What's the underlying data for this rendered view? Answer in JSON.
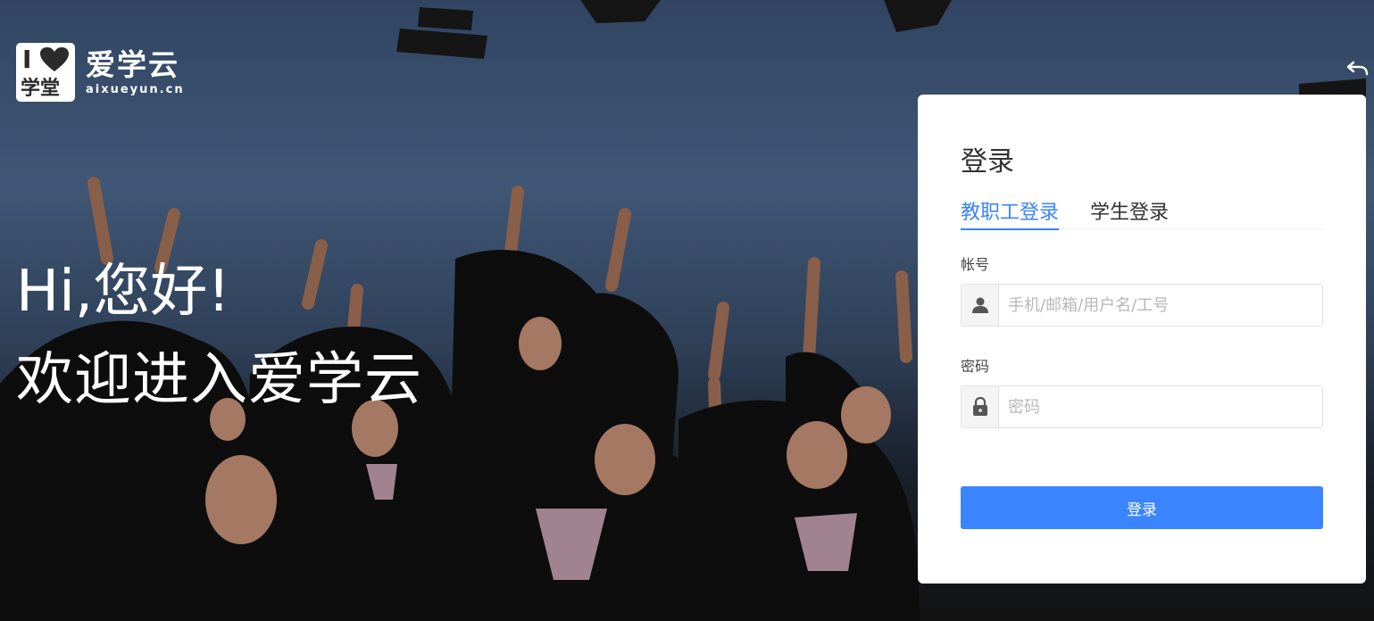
{
  "brand": {
    "badge_letter": "I",
    "badge_text": "学堂",
    "name": "爱学云",
    "domain": "aixueyun.cn"
  },
  "welcome": {
    "line1": "Hi,您好!",
    "line2": "欢迎进入爱学云"
  },
  "login": {
    "title": "登录",
    "tabs": [
      {
        "label": "教职工登录",
        "active": true
      },
      {
        "label": "学生登录",
        "active": false
      }
    ],
    "account_label": "帐号",
    "account_placeholder": "手机/邮箱/用户名/工号",
    "account_value": "",
    "password_label": "密码",
    "password_placeholder": "密码",
    "password_value": "",
    "submit_label": "登录"
  },
  "icons": {
    "user": "user-icon",
    "lock": "lock-icon",
    "heart": "heart-icon",
    "undo": "undo-icon"
  },
  "colors": {
    "accent": "#3a84ff",
    "card_bg": "#ffffff"
  }
}
